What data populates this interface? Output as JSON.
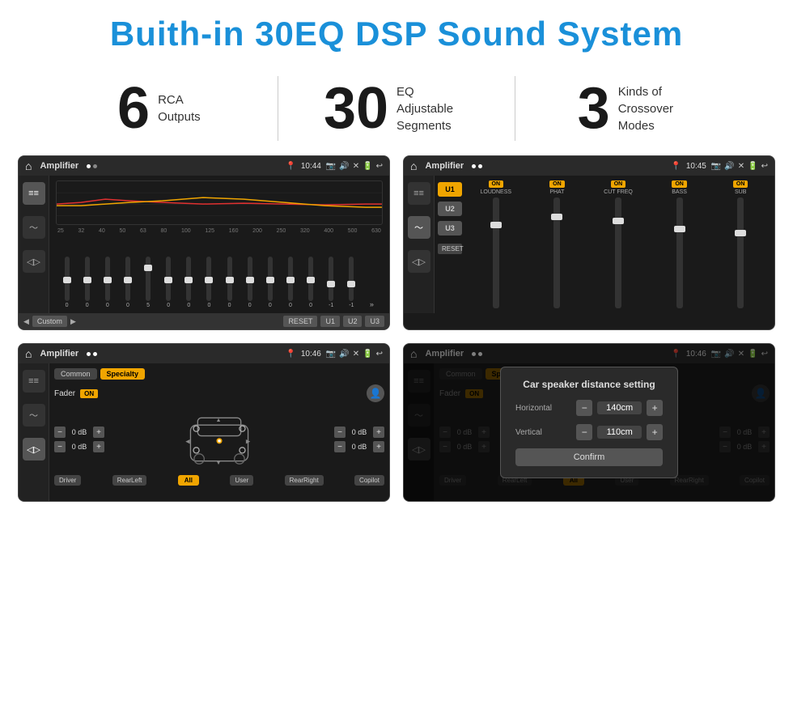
{
  "header": {
    "title": "Buith-in 30EQ DSP Sound System"
  },
  "stats": [
    {
      "number": "6",
      "text_line1": "RCA",
      "text_line2": "Outputs"
    },
    {
      "number": "30",
      "text_line1": "EQ Adjustable",
      "text_line2": "Segments"
    },
    {
      "number": "3",
      "text_line1": "Kinds of",
      "text_line2": "Crossover Modes"
    }
  ],
  "screens": [
    {
      "id": "screen1",
      "status": {
        "title": "Amplifier",
        "time": "10:44"
      },
      "type": "equalizer"
    },
    {
      "id": "screen2",
      "status": {
        "title": "Amplifier",
        "time": "10:45"
      },
      "type": "crossover"
    },
    {
      "id": "screen3",
      "status": {
        "title": "Amplifier",
        "time": "10:46"
      },
      "type": "fader"
    },
    {
      "id": "screen4",
      "status": {
        "title": "Amplifier",
        "time": "10:46"
      },
      "type": "distance",
      "dialog": {
        "title": "Car speaker distance setting",
        "horizontal_label": "Horizontal",
        "horizontal_value": "140cm",
        "vertical_label": "Vertical",
        "vertical_value": "110cm",
        "confirm_label": "Confirm"
      }
    }
  ],
  "eq": {
    "frequencies": [
      "25",
      "32",
      "40",
      "50",
      "63",
      "80",
      "100",
      "125",
      "160",
      "200",
      "250",
      "320",
      "400",
      "500",
      "630"
    ],
    "values": [
      "0",
      "0",
      "0",
      "0",
      "5",
      "0",
      "0",
      "0",
      "0",
      "0",
      "0",
      "0",
      "0",
      "-1",
      "0",
      "-1"
    ],
    "buttons": [
      "Custom",
      "RESET",
      "U1",
      "U2",
      "U3"
    ]
  },
  "crossover": {
    "u_buttons": [
      "U1",
      "U2",
      "U3"
    ],
    "controls": [
      "LOUDNESS",
      "PHAT",
      "CUT FREQ",
      "BASS",
      "SUB"
    ],
    "reset_label": "RESET"
  },
  "fader": {
    "tabs": [
      "Common",
      "Specialty"
    ],
    "fader_label": "Fader",
    "toggle_label": "ON",
    "levels": [
      "0 dB",
      "0 dB",
      "0 dB",
      "0 dB"
    ],
    "bottom_buttons": [
      "Driver",
      "RearLeft",
      "All",
      "User",
      "RearRight",
      "Copilot"
    ]
  },
  "distance_dialog": {
    "title": "Car speaker distance setting",
    "horizontal_label": "Horizontal",
    "horizontal_value": "140cm",
    "vertical_label": "Vertical",
    "vertical_value": "110cm",
    "confirm_label": "Confirm"
  }
}
